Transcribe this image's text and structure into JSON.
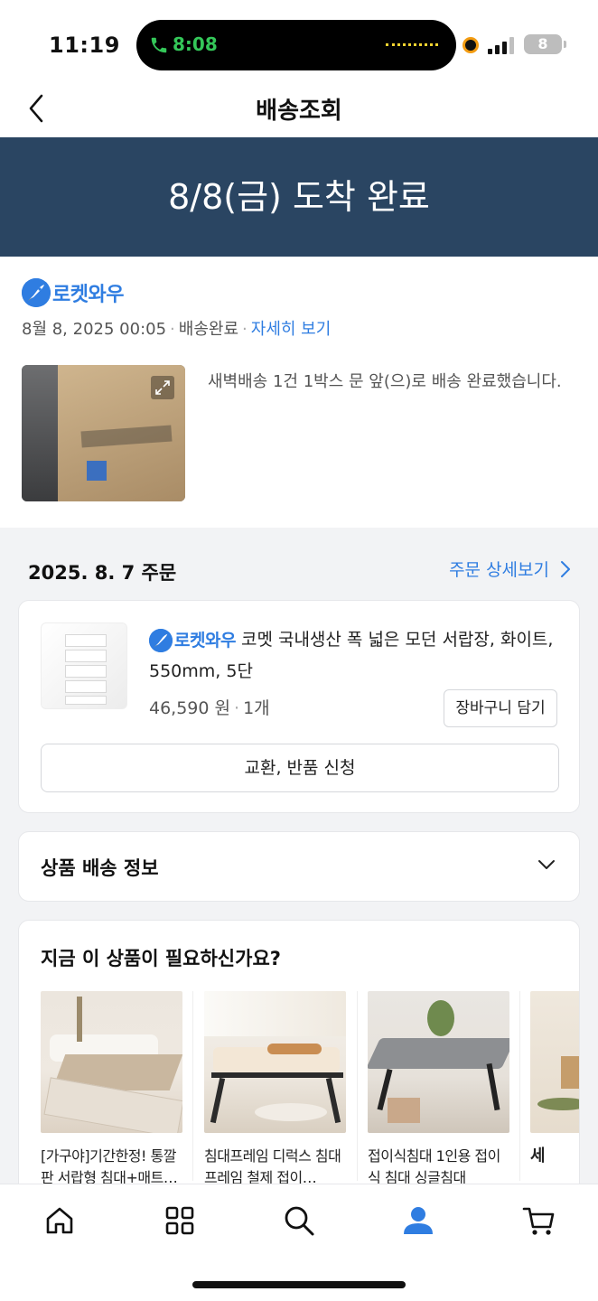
{
  "status_bar": {
    "time": "11:19",
    "call_time": "8:08",
    "battery": "8"
  },
  "header": {
    "title": "배송조회"
  },
  "banner": {
    "text": "8/8(금) 도착 완료"
  },
  "delivery": {
    "brand": "로켓와우",
    "datetime": "8월 8, 2025 00:05",
    "status": "배송완료",
    "detail_link": "자세히 보기",
    "description": "새벽배송 1건 1박스 문 앞(으)로 배송 완료했습니다."
  },
  "order": {
    "date": "2025. 8. 7 주문",
    "detail_link": "주문 상세보기",
    "item": {
      "brand": "로켓와우",
      "name": "코멧 국내생산 폭 넓은 모던 서랍장, 화이트, 550mm, 5단",
      "price": "46,590 원",
      "quantity": "1개",
      "cart_button": "장바구니 담기"
    },
    "return_button": "교환, 반품 신청"
  },
  "shipping_info": {
    "label": "상품 배송 정보"
  },
  "recommend": {
    "title": "지금 이 상품이 필요하신가요?",
    "items": [
      {
        "name": "[가구야]기간한정! 통깔판 서랍형 침대+매트…"
      },
      {
        "name": "침대프레임 디럭스 침대 프레임 철제 접이…"
      },
      {
        "name": "접이식침대 1인용 접이식 침대 싱글침대"
      },
      {
        "name": "세"
      }
    ]
  },
  "nav": {
    "items": [
      "home-icon",
      "category-icon",
      "search-icon",
      "my-account-icon",
      "cart-icon"
    ],
    "active_color": "#2f7de1"
  },
  "colors": {
    "banner_bg": "#2a4562",
    "accent": "#2f7de1"
  }
}
